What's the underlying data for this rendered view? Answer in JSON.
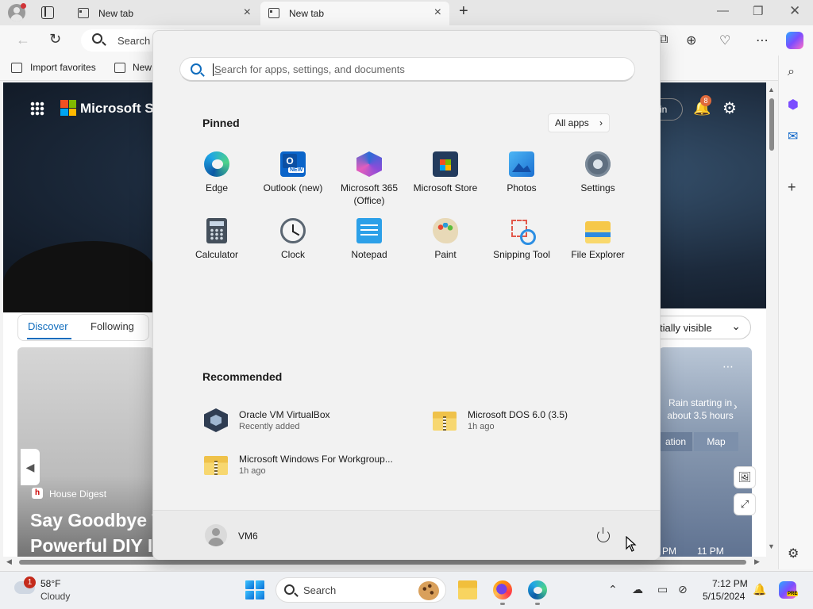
{
  "browser": {
    "tabs": [
      {
        "title": "New tab"
      },
      {
        "title": "New tab"
      }
    ],
    "omnibox_placeholder": "Search",
    "favorites": [
      {
        "label": "Import favorites"
      },
      {
        "label": "New"
      }
    ]
  },
  "page": {
    "brand": "Microsoft Sta",
    "signin": "in",
    "notification_count": "8",
    "feed_tabs": [
      "Discover",
      "Following"
    ],
    "visibility": "tially visible",
    "source": "House Digest",
    "headline": "Say Goodbye T Powerful DIY I",
    "weather_text": "Rain starting in about 3.5 hours",
    "weather_tabs": [
      "ation",
      "Map"
    ],
    "times": [
      "PM",
      "11 PM"
    ]
  },
  "start_menu": {
    "search_placeholder": "Search for apps, settings, and documents",
    "pinned_title": "Pinned",
    "all_apps": "All apps",
    "pinned": [
      {
        "label": "Edge",
        "icon": "edge-icon"
      },
      {
        "label": "Outlook (new)",
        "icon": "outlook-icon"
      },
      {
        "label": "Microsoft 365 (Office)",
        "icon": "m365-icon"
      },
      {
        "label": "Microsoft Store",
        "icon": "store-icon"
      },
      {
        "label": "Photos",
        "icon": "photos-icon"
      },
      {
        "label": "Settings",
        "icon": "settings-icon"
      },
      {
        "label": "Calculator",
        "icon": "calculator-icon"
      },
      {
        "label": "Clock",
        "icon": "clock-icon"
      },
      {
        "label": "Notepad",
        "icon": "notepad-icon"
      },
      {
        "label": "Paint",
        "icon": "paint-icon"
      },
      {
        "label": "Snipping Tool",
        "icon": "snipping-tool-icon"
      },
      {
        "label": "File Explorer",
        "icon": "file-explorer-icon"
      }
    ],
    "recommended_title": "Recommended",
    "recommended": [
      {
        "name": "Oracle VM VirtualBox",
        "sub": "Recently added",
        "icon": "virtualbox-icon"
      },
      {
        "name": "Microsoft DOS 6.0 (3.5)",
        "sub": "1h ago",
        "icon": "zip-folder-icon"
      },
      {
        "name": "Microsoft Windows For Workgroup...",
        "sub": "1h ago",
        "icon": "zip-folder-icon"
      }
    ],
    "user": "VM6"
  },
  "taskbar": {
    "weather_temp": "58°F",
    "weather_cond": "Cloudy",
    "weather_badge": "1",
    "search_label": "Search",
    "time": "7:12 PM",
    "date": "5/15/2024",
    "copilot_badge": "PRE"
  },
  "colors": {
    "accent": "#0f6cbd",
    "start_bg": "#f2f2f2",
    "taskbar_bg": "#eef0f3"
  }
}
